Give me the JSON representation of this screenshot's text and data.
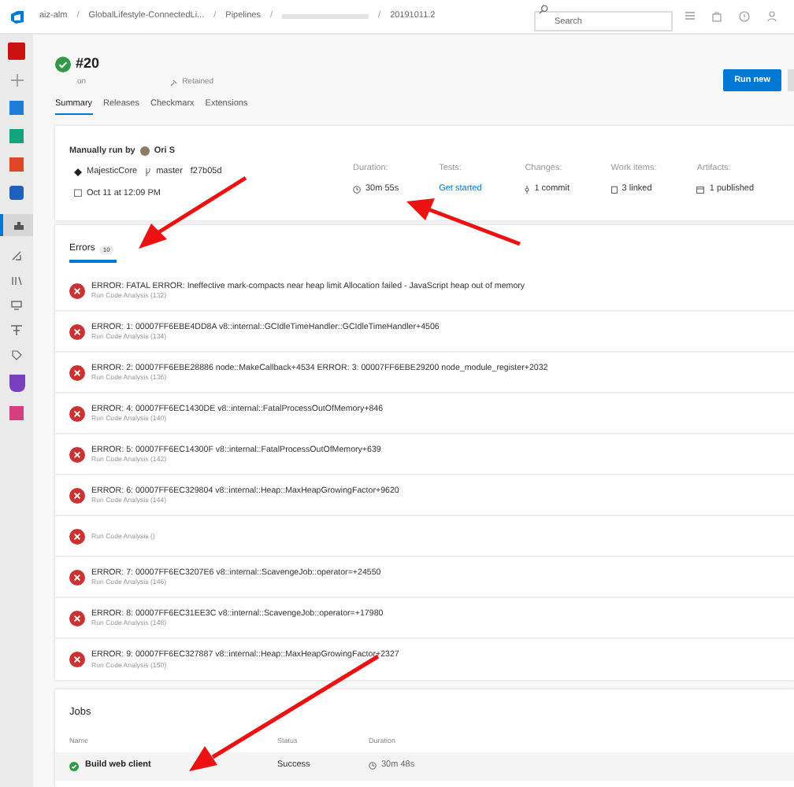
{
  "breadcrumb": [
    {
      "kind": "link",
      "text": "aiz-alm"
    },
    {
      "kind": "separator",
      "text": "/"
    },
    {
      "kind": "link",
      "text": "GlobalLifestyle-ConnectedLi..."
    },
    {
      "kind": "separator",
      "text": "/"
    },
    {
      "kind": "link",
      "text": "Pipelines"
    },
    {
      "kind": "separator",
      "text": "/"
    },
    {
      "kind": "redacted"
    },
    {
      "kind": "separator",
      "text": "/"
    },
    {
      "kind": "link",
      "text": "20191011.2"
    }
  ],
  "search": {
    "placeholder": "Search"
  },
  "run": {
    "title": "#20",
    "subtitle": "on",
    "retained": "Retained",
    "tabs": [
      {
        "label": "Summary",
        "selected": true
      },
      {
        "label": "Releases",
        "selected": false
      },
      {
        "label": "Checkmarx",
        "selected": false
      },
      {
        "label": "Extensions",
        "selected": false
      }
    ],
    "run_new": "Run new"
  },
  "summary": {
    "trigger": "Manually run by",
    "user": "Ori S",
    "repo": "MajesticCore",
    "branch": "master",
    "commit": "f27b05d",
    "date": "Oct 11 at 12:09 PM",
    "stats": [
      {
        "label": "Duration:",
        "value": "30m 55s",
        "kind": "duration"
      },
      {
        "label": "Tests:",
        "value": "Get started",
        "kind": "link"
      },
      {
        "label": "Changes:",
        "value": "1 commit",
        "kind": "commit"
      },
      {
        "label": "Work items:",
        "value": "3 linked",
        "kind": "workitem"
      },
      {
        "label": "Artifacts:",
        "value": "1 published",
        "kind": "artifact"
      }
    ]
  },
  "errors": {
    "title": "Errors",
    "count": "10",
    "items": [
      {
        "message": "ERROR: FATAL ERROR: Ineffective mark-compacts near heap limit Allocation failed - JavaScript heap out of memory",
        "source": "Run Code Analysis (132)"
      },
      {
        "message": "ERROR: 1: 00007FF6EBE4DD8A v8::internal::GCIdleTimeHandler::GCIdleTimeHandler+4506",
        "source": "Run Code Analysis (134)"
      },
      {
        "message": "ERROR: 2: 00007FF6EBE28886 node::MakeCallback+4534 ERROR: 3: 00007FF6EBE29200 node_module_register+2032",
        "source": "Run Code Analysis (136)"
      },
      {
        "message": "ERROR: 4: 00007FF6EC1430DE v8::internal::FatalProcessOutOfMemory+846",
        "source": "Run Code Analysis (140)"
      },
      {
        "message": "ERROR: 5: 00007FF6EC14300F v8::internal::FatalProcessOutOfMemory+639",
        "source": "Run Code Analysis (142)"
      },
      {
        "message": "ERROR: 6: 00007FF6EC329804 v8::internal::Heap::MaxHeapGrowingFactor+9620",
        "source": "Run Code Analysis (144)"
      },
      {
        "source": "Run Code Analysis ()"
      },
      {
        "message": "ERROR: 7: 00007FF6EC3207E6 v8::internal::ScavengeJob::operator=+24550",
        "source": "Run Code Analysis (146)"
      },
      {
        "message": "ERROR: 8: 00007FF6EC31EE3C v8::internal::ScavengeJob::operator=+17980",
        "source": "Run Code Analysis (148)"
      },
      {
        "message": "ERROR: 9: 00007FF6EC327887 v8::internal::Heap::MaxHeapGrowingFactor+2327",
        "source": "Run Code Analysis (150)"
      }
    ]
  },
  "jobs": {
    "title": "Jobs",
    "columns": [
      "Name",
      "Status",
      "Duration"
    ],
    "rows": [
      {
        "name": "Build web client",
        "status": "Success",
        "duration": "30m 48s"
      }
    ]
  }
}
